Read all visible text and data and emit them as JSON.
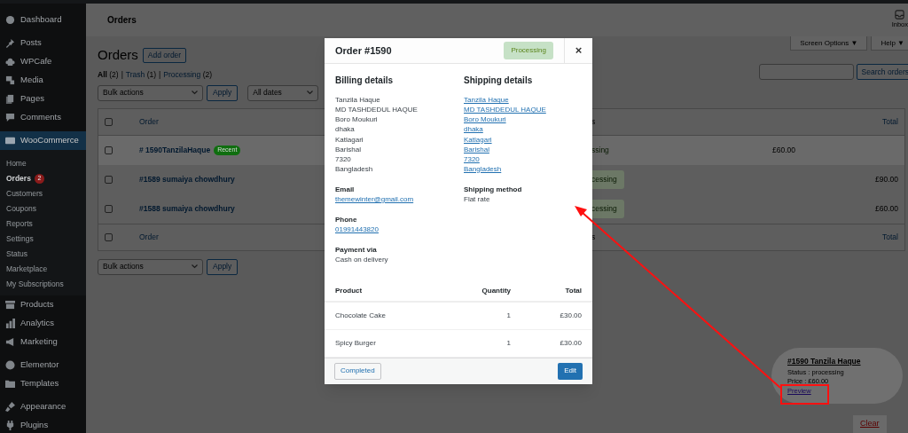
{
  "sidebar": {
    "sections": [
      [
        {
          "label": "Dashboard",
          "selected": false
        }
      ],
      [
        {
          "label": "Posts",
          "selected": false
        },
        {
          "label": "WPCafe",
          "selected": false
        },
        {
          "label": "Media",
          "selected": false
        },
        {
          "label": "Pages",
          "selected": false
        },
        {
          "label": "Comments",
          "selected": false
        }
      ],
      [
        {
          "label": "WooCommerce",
          "selected": true,
          "children": [
            {
              "label": "Home",
              "selected": false
            },
            {
              "label": "Orders",
              "selected": true,
              "badge": "2"
            },
            {
              "label": "Customers",
              "selected": false
            },
            {
              "label": "Coupons",
              "selected": false
            },
            {
              "label": "Reports",
              "selected": false
            },
            {
              "label": "Settings",
              "selected": false
            },
            {
              "label": "Status",
              "selected": false
            },
            {
              "label": "Marketplace",
              "selected": false
            },
            {
              "label": "My Subscriptions",
              "selected": false
            }
          ]
        },
        {
          "label": "Products",
          "selected": false
        },
        {
          "label": "Analytics",
          "selected": false
        },
        {
          "label": "Marketing",
          "selected": false
        }
      ],
      [
        {
          "label": "Elementor",
          "selected": false
        },
        {
          "label": "Templates",
          "selected": false
        }
      ],
      [
        {
          "label": "Appearance",
          "selected": false
        },
        {
          "label": "Plugins",
          "selected": false
        }
      ]
    ]
  },
  "header": {
    "title": "Orders",
    "inbox": "Inbox"
  },
  "screen_tabs": [
    "Screen Options ▼",
    "Help ▼"
  ],
  "page": {
    "heading": "Orders",
    "add_button": "Add order",
    "filters": [
      {
        "label": "All",
        "count": "(2)",
        "selected": true
      },
      {
        "separator": "|",
        "label": "Trash",
        "count": "(1)",
        "selected": false
      },
      {
        "separator": "|",
        "label": "Processing",
        "count": "(2)",
        "selected": false
      }
    ],
    "bulk_actions": "Bulk actions",
    "apply": "Apply",
    "dates": "All dates",
    "search_button": "Search orders"
  },
  "table": {
    "columns": [
      "Order",
      "s",
      "Total"
    ],
    "header_checked": false,
    "footer_checked": false,
    "rows": [
      {
        "order": "# 1590TanzilaHaque",
        "badge": "Recent",
        "status": "ssing",
        "status_pill": false,
        "column_4": "£60.00",
        "total": "",
        "selected": true,
        "checked": false
      },
      {
        "order": "#1589 sumaiya chowdhury",
        "status": "cessing",
        "status_pill": true,
        "total": "£90.00",
        "selected": false,
        "checked": false
      },
      {
        "order": "#1588 sumaiya chowdhury",
        "status": "cessing",
        "status_pill": true,
        "total": "£60.00",
        "selected": false,
        "checked": false
      }
    ],
    "footer_columns": [
      "Order",
      "s",
      "Total"
    ]
  },
  "bottom_bulk": {
    "bulk_actions": "Bulk actions",
    "apply": "Apply"
  },
  "modal": {
    "title": "Order #1590",
    "status": "Processing",
    "close": "×",
    "billing": {
      "heading": "Billing details",
      "lines": [
        "Tanzila Haque",
        "MD TASHDEDUL HAQUE",
        "Boro Moukuri",
        "dhaka",
        "Katlagari",
        "Barishal",
        "7320",
        "Bangladesh"
      ],
      "fields": [
        {
          "label": "Email",
          "value": "themewinter@gmail.com",
          "link": true
        },
        {
          "label": "Phone",
          "value": "01991443820",
          "link": true
        },
        {
          "label": "Payment via",
          "value": "Cash on delivery",
          "link": false
        }
      ]
    },
    "shipping": {
      "heading": "Shipping details",
      "lines": [
        "Tanzila Haque",
        "MD TASHDEDUL HAQUE",
        "Boro Moukuri",
        "dhaka",
        "Katlagari",
        "Barishal",
        "7320",
        "Bangladesh"
      ],
      "fields": [
        {
          "label": "Shipping method",
          "value": "Flat rate",
          "link": false
        }
      ]
    },
    "products": {
      "columns": [
        "Product",
        "Quantity",
        "Total"
      ],
      "rows": [
        [
          "Chocolate Cake",
          "1",
          "£30.00"
        ],
        [
          "Spicy Burger",
          "1",
          "£30.00"
        ]
      ]
    },
    "buttons": [
      "Completed",
      "Edit"
    ]
  },
  "notification": {
    "title": "#1590 Tanzila Haque",
    "status": "Status : processing",
    "price": "Price : £60.00",
    "link": "Preview",
    "clear": "Clear"
  }
}
